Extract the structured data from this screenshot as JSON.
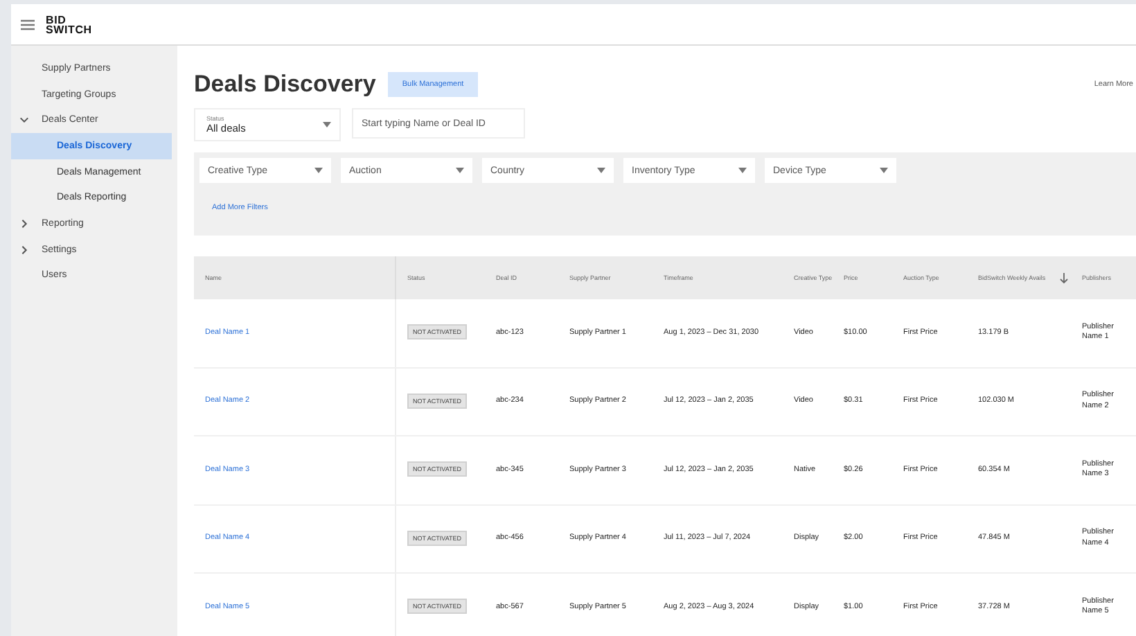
{
  "header": {
    "logo_line_1": "BID",
    "logo_line_2": "SWITCH"
  },
  "sidebar": {
    "items": [
      {
        "kind": "link",
        "label": "Supply Partners",
        "selected": false
      },
      {
        "kind": "link",
        "label": "Targeting Groups",
        "selected": false
      },
      {
        "kind": "group",
        "label": "Deals Center",
        "selected": false,
        "expanded": true,
        "children": [
          {
            "label": "Deals Discovery",
            "selected": true
          },
          {
            "label": "Deals Management",
            "selected": false
          },
          {
            "label": "Deals Reporting",
            "selected": false
          }
        ]
      },
      {
        "kind": "group",
        "label": "Reporting",
        "selected": false,
        "expanded": false
      },
      {
        "kind": "group",
        "label": "Settings",
        "selected": false,
        "expanded": false
      },
      {
        "kind": "link",
        "label": "Users",
        "selected": false
      }
    ]
  },
  "page": {
    "title": "Deals Discovery",
    "bulk_button": "Bulk Management",
    "learn_more": "Learn More"
  },
  "status_select": {
    "label": "Status",
    "value": "All deals"
  },
  "search": {
    "placeholder": "Start typing Name or Deal ID"
  },
  "filters": [
    "Creative Type",
    "Auction",
    "Country",
    "Inventory Type",
    "Device Type"
  ],
  "add_filters": "Add More Filters",
  "table": {
    "columns": [
      "Name",
      "Status",
      "Deal ID",
      "Supply Partner",
      "Timeframe",
      "Creative Type",
      "Price",
      "Auction Type",
      "BidSwitch Weekly Avails",
      "Publishers"
    ],
    "rows": [
      {
        "name": "Deal Name 1",
        "status": "NOT ACTIVATED",
        "deal_id": "abc-123",
        "partner": "Supply Partner 1",
        "timeframe": "Aug 1, 2023 – Dec 31, 2030",
        "creative": "Video",
        "price": "$10.00",
        "auction": "First Price",
        "avails": "13.179 B",
        "publisher": "Publisher Name 1"
      },
      {
        "name": "Deal Name 2",
        "status": "NOT ACTIVATED",
        "deal_id": "abc-234",
        "partner": "Supply Partner 2",
        "timeframe": "Jul 12, 2023 – Jan 2, 2035",
        "creative": "Video",
        "price": "$0.31",
        "auction": "First Price",
        "avails": "102.030 M",
        "publisher": "Publisher Name 2"
      },
      {
        "name": "Deal Name 3",
        "status": "NOT ACTIVATED",
        "deal_id": "abc-345",
        "partner": "Supply Partner 3",
        "timeframe": "Jul 12, 2023 – Jan 2, 2035",
        "creative": "Native",
        "price": "$0.26",
        "auction": "First Price",
        "avails": "60.354 M",
        "publisher": "Publisher Name 3"
      },
      {
        "name": "Deal Name 4",
        "status": "NOT ACTIVATED",
        "deal_id": "abc-456",
        "partner": "Supply Partner 4",
        "timeframe": "Jul 11, 2023 – Jul 7, 2024",
        "creative": "Display",
        "price": "$2.00",
        "auction": "First Price",
        "avails": "47.845 M",
        "publisher": "Publisher Name 4"
      },
      {
        "name": "Deal Name 5",
        "status": "NOT ACTIVATED",
        "deal_id": "abc-567",
        "partner": "Supply Partner 5",
        "timeframe": "Aug 2, 2023 – Aug 3, 2024",
        "creative": "Display",
        "price": "$1.00",
        "auction": "First Price",
        "avails": "37.728 M",
        "publisher": "Publisher Name 5"
      }
    ]
  }
}
